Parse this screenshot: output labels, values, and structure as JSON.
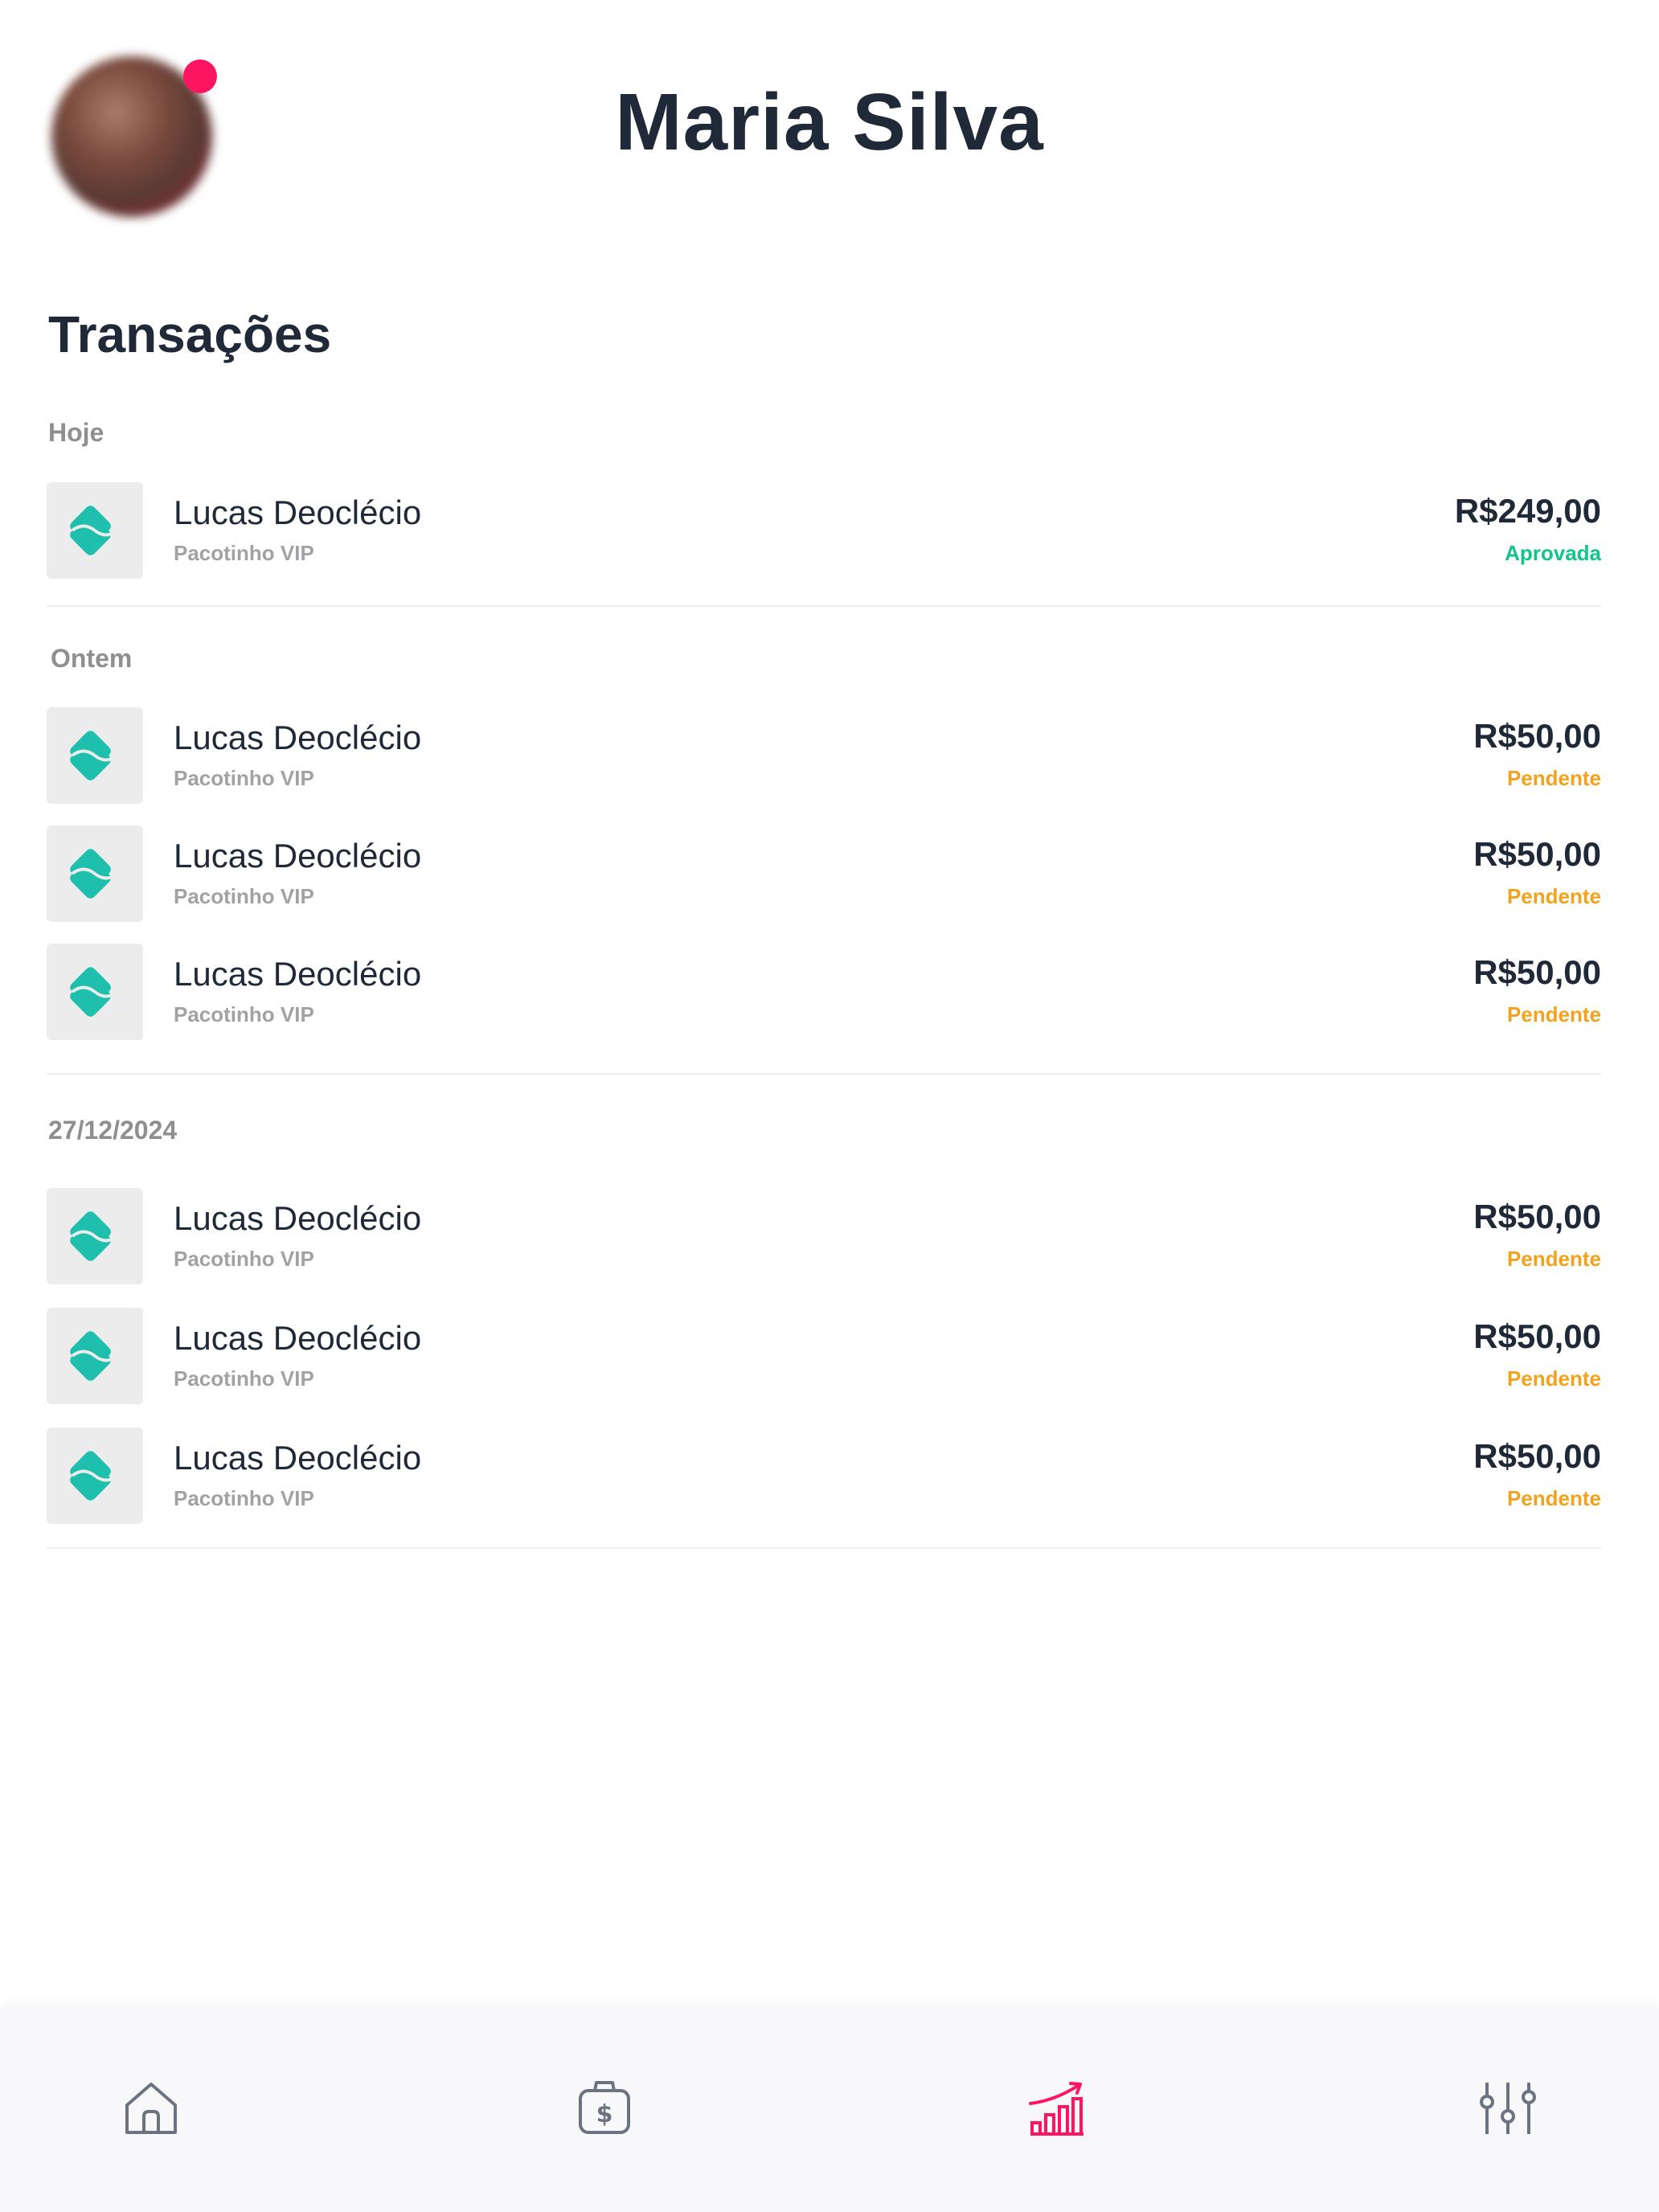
{
  "profile": {
    "name": "Maria Silva",
    "notification_color": "#ff1461"
  },
  "transactions": {
    "title": "Transações",
    "groups": [
      {
        "label": "Hoje",
        "items": [
          {
            "icon": "pix-icon",
            "name": "Lucas Deoclécio",
            "description": "Pacotinho VIP",
            "amount": "R$249,00",
            "status": "Aprovada",
            "status_type": "approved"
          }
        ]
      },
      {
        "label": "Ontem",
        "items": [
          {
            "icon": "pix-icon",
            "name": "Lucas Deoclécio",
            "description": "Pacotinho VIP",
            "amount": "R$50,00",
            "status": "Pendente",
            "status_type": "pending"
          },
          {
            "icon": "pix-icon",
            "name": "Lucas Deoclécio",
            "description": "Pacotinho VIP",
            "amount": "R$50,00",
            "status": "Pendente",
            "status_type": "pending"
          },
          {
            "icon": "pix-icon",
            "name": "Lucas Deoclécio",
            "description": "Pacotinho VIP",
            "amount": "R$50,00",
            "status": "Pendente",
            "status_type": "pending"
          }
        ]
      },
      {
        "label": "27/12/2024",
        "items": [
          {
            "icon": "pix-icon",
            "name": "Lucas Deoclécio",
            "description": "Pacotinho VIP",
            "amount": "R$50,00",
            "status": "Pendente",
            "status_type": "pending"
          },
          {
            "icon": "pix-icon",
            "name": "Lucas Deoclécio",
            "description": "Pacotinho VIP",
            "amount": "R$50,00",
            "status": "Pendente",
            "status_type": "pending"
          },
          {
            "icon": "pix-icon",
            "name": "Lucas Deoclécio",
            "description": "Pacotinho VIP",
            "amount": "R$50,00",
            "status": "Pendente",
            "status_type": "pending"
          }
        ]
      }
    ]
  },
  "colors": {
    "accent": "#ff1461",
    "pix": "#1fbfae",
    "approved": "#10c48a",
    "pending": "#f4a21c"
  },
  "bottom_nav": {
    "items": [
      {
        "icon": "home-icon",
        "active": false
      },
      {
        "icon": "money-bag-icon",
        "active": false
      },
      {
        "icon": "chart-growth-icon",
        "active": true
      },
      {
        "icon": "sliders-icon",
        "active": false
      }
    ]
  }
}
